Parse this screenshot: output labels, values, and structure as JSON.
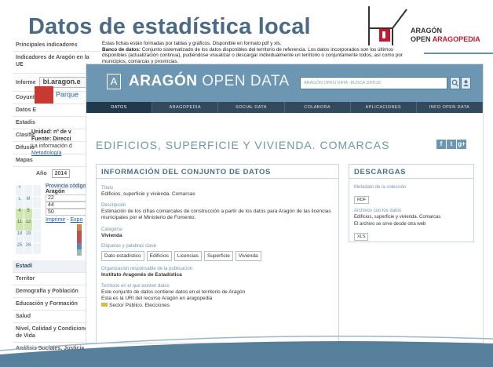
{
  "slide": {
    "title": "Datos de estadística local",
    "logo_line1": "ARAGÓN",
    "logo_line2_a": "OPEN ",
    "logo_line2_b": "ARAGOPEDIA",
    "colors": {
      "title": "#4a6a86",
      "brand_bar": "#6d96b2",
      "nav_bar": "#33495c",
      "swoosh": "#3a6a8c"
    }
  },
  "back": {
    "sidebar_rows": [
      "Principales indicadores",
      "Indicadores de Aragón en la UE"
    ],
    "informe_label": "Informe",
    "search_value": "bi.aragon.e",
    "short_rows": [
      "Coyunt",
      "Datos E"
    ],
    "parque_label": "Parque",
    "estadis_label": "Estadis",
    "unidad_text": "Unidad: nº de v",
    "fuente_text": "Fuente: Direcci",
    "clasific_label": "Clasific",
    "clasific_text": "La información d",
    "metodologia": "Metodología",
    "difusion_label": "Difusió",
    "mapas_label": "Mapas",
    "year_label": "Año",
    "year_value": "2014",
    "provincia_header": "Provincia código",
    "aragon_label": "Aragón",
    "codes": [
      "22",
      "44",
      "50"
    ],
    "calendar": [
      "«",
      "",
      "",
      "L",
      "M",
      "",
      "4",
      "5",
      "",
      "11",
      "12",
      "",
      "18",
      "19",
      "",
      "25",
      "26",
      ""
    ],
    "imprimir": "Imprimir",
    "exportar": "Expo",
    "estadi_row": "Estadí",
    "territorio": "Territor",
    "categories": [
      "Demografía y Población",
      "Educación y Formación",
      "Salud",
      "Nivel, Calidad y Condiciones de Vida",
      "Análisis Sociales, Justicia,"
    ],
    "top_desc_1": "Estas fichas están formadas por tablas y gráficos. Disponible en formato pdf y xls.",
    "top_desc_2_bold": "Banco de datos:",
    "top_desc_2": " Conjunto sistematizado de los datos disponibles del territorio de referencia. Los datos incorporados son los últimos disponibles (actualización continua), pudiéndose visualizar o descargar individualmente un territorio o conjuntamente todos, así como por municipios, comarcas y provincias."
  },
  "window": {
    "brand_box": "A",
    "brand_bold": "ARAGÓN",
    "brand_light": " OPEN DATA",
    "search_placeholder": "ARAGÓN OPEN DATA: BUSCA DATOS",
    "nav": [
      "DATOS",
      "ARAGOPEDIA",
      "SOCIAL DATA",
      "COLABORA",
      "APLICACIONES",
      "INFO OPEN DATA"
    ],
    "nav_active": 0,
    "page_heading": "EDIFICIOS, SUPERFICIE Y VIVIENDA. COMARCAS",
    "share": [
      "f",
      "t",
      "g+"
    ],
    "info_title": "INFORMACIÓN DEL CONJUNTO DE DATOS",
    "titulo_label": "Título",
    "titulo_value": "Edificios, superficie y vivienda. Comarcas",
    "descripcion_label": "Descripción",
    "descripcion_value": "Estimación de los cifras comarcales de construcción a partir de los datos para Aragón de las licencias municipales por el Ministerio de Fomento.",
    "categoria_label": "Categoría",
    "categoria_value": "Vivienda",
    "etiquetas_label": "Etiquetas y palabras clave",
    "tags": [
      "Dato estadístico",
      "Edificios",
      "Licencias",
      "Superficie",
      "Vivienda"
    ],
    "org_label": "Organización responsable de la publicación",
    "org_value": "Instituto Aragonés de Estadística",
    "territorio_label": "Territorio en el que existen datos",
    "territorio_value_1": "Este conjunto de datos contiene datos en el territorio de Aragón",
    "territorio_value_2": "Esta es la URI del recurso Aragón en aragopedia",
    "territorio_value_3": "Sector Público. Elecciones",
    "descargas_title": "DESCARGAS",
    "metadata_label": "Metadato de la colección",
    "metadata_format": "RDF",
    "archivos_label": "Archivos con los datos",
    "archivos_value": "Edificios, superficie y vivienda. Comarcas",
    "archivo_note": "El archivo se sirve desde otra web",
    "archivo_format": "XLS"
  }
}
